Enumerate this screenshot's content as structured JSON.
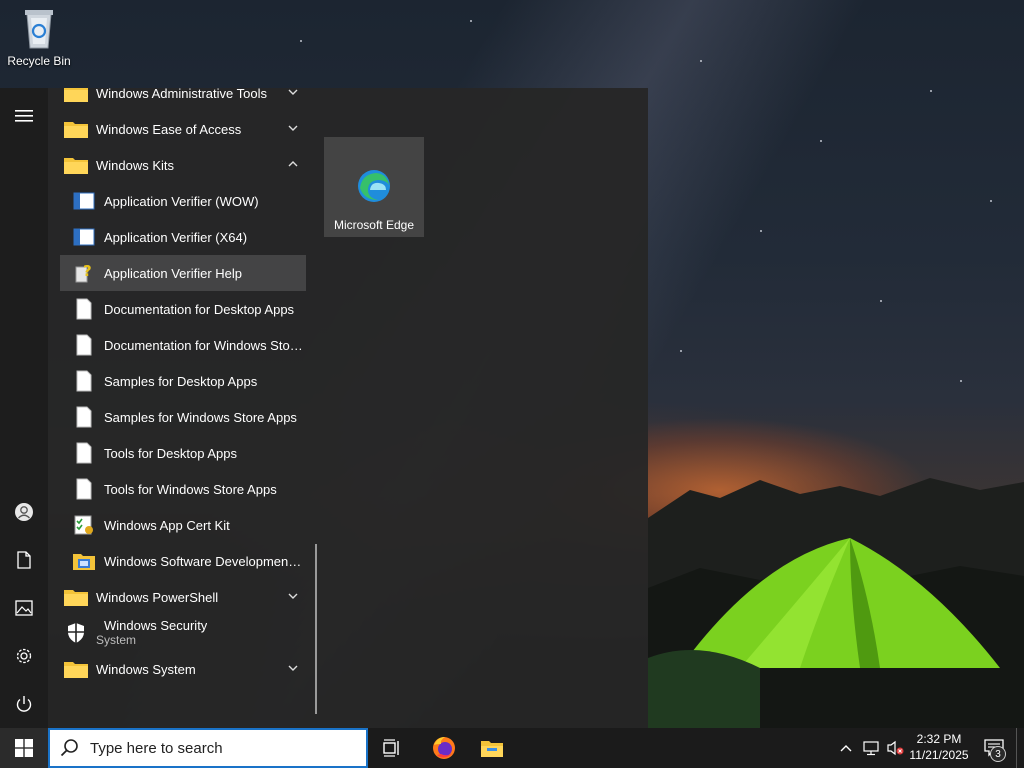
{
  "desktop": {
    "recycle_bin_label": "Recycle Bin"
  },
  "start_menu": {
    "rail": [
      {
        "name": "hamburger-menu-icon"
      },
      {
        "name": "user-account-icon"
      },
      {
        "name": "documents-icon"
      },
      {
        "name": "pictures-icon"
      },
      {
        "name": "settings-gear-icon"
      },
      {
        "name": "power-icon"
      }
    ],
    "apps": {
      "windows_administrative_tools": "Windows Administrative Tools",
      "windows_ease_of_access": "Windows Ease of Access",
      "windows_kits": "Windows Kits",
      "app_verifier_wow": "Application Verifier (WOW)",
      "app_verifier_x64": "Application Verifier (X64)",
      "app_verifier_help": "Application Verifier Help",
      "docs_desktop_apps": "Documentation for Desktop Apps",
      "docs_windows_store": "Documentation for Windows Store...",
      "samples_desktop_apps": "Samples for Desktop Apps",
      "samples_windows_store": "Samples for Windows Store Apps",
      "tools_desktop_apps": "Tools for Desktop Apps",
      "tools_windows_store": "Tools for Windows Store Apps",
      "windows_app_cert_kit": "Windows App Cert Kit",
      "windows_sdk": "Windows Software Development Kit",
      "windows_powershell": "Windows PowerShell",
      "windows_security": "Windows Security",
      "windows_security_sub": "System",
      "windows_system": "Windows System"
    },
    "tiles": {
      "edge_label": "Microsoft Edge"
    }
  },
  "taskbar": {
    "search_placeholder": "Type here to search",
    "clock_time": "2:32 PM",
    "clock_date": "11/21/2025",
    "notification_count": "3"
  },
  "colors": {
    "accent": "#1a73c8",
    "folder": "#f3c339",
    "start_bg": "#262626",
    "taskbar_bg": "#1b1b1b"
  }
}
